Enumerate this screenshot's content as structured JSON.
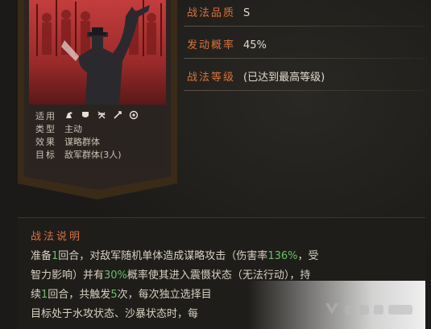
{
  "card": {
    "rows": [
      {
        "key": "适用",
        "value": ""
      },
      {
        "key": "类型",
        "value": "主动"
      },
      {
        "key": "效果",
        "value": "谋略群体"
      },
      {
        "key": "目标",
        "value": "敌军群体(3人)"
      }
    ],
    "icons": [
      "cavalry-icon",
      "shield-icon",
      "bow-icon",
      "spear-icon",
      "siege-icon"
    ]
  },
  "attributes": [
    {
      "label": "战法品质",
      "value": "S"
    },
    {
      "label": "发动概率",
      "value": "45%"
    },
    {
      "label": "战法等级",
      "value": "(已达到最高等级)"
    }
  ],
  "description": {
    "title": "战法说明",
    "line1_a": "准备",
    "line1_hl": "1",
    "line1_b": "回合，对敌军随机单体造成谋略攻击（伤害率",
    "line1_hl2": "136%",
    "line1_c": "，受",
    "line2_a": "智力影响）并有",
    "line2_hl": "30%",
    "line2_b": "概率使其进入震慑状态（无法行动），持",
    "line3_a": "续",
    "line3_hl": "1",
    "line3_b": "回合，共触发",
    "line3_hl2": "5",
    "line3_c": "次，每次独立选择目",
    "line4": "目标处于水攻状态、沙暴状态时，每"
  },
  "colors": {
    "accent": "#d9733a",
    "highlight": "#69c06a",
    "art_red": "#c43d3d"
  }
}
